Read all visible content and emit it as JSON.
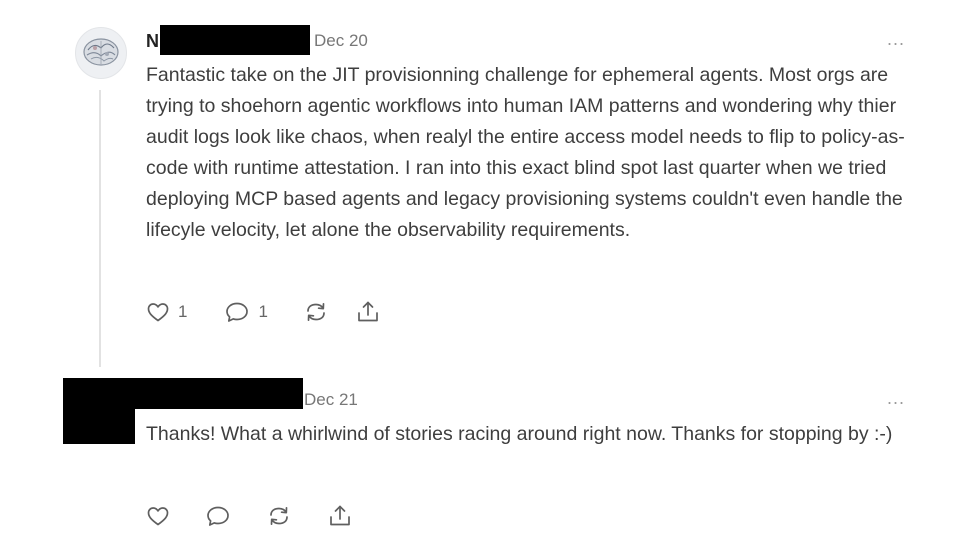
{
  "comments": [
    {
      "author_initial": "N",
      "date": "Dec 20",
      "more_label": "...",
      "text": "Fantastic take on the JIT provisionning challenge for ephemeral agents. Most orgs are trying to shoehorn agentic workflows into human IAM patterns and wondering why thier audit logs look like chaos, when realyl the entire access model needs to flip to policy-as-code with runtime attestation. I ran into this exact blind spot last quarter when we tried deploying MCP based agents and legacy provisioning systems couldn't even handle the lifecyle velocity, let alone the observability requirements.",
      "likes": "1",
      "replies": "1"
    },
    {
      "date": "Dec 21",
      "more_label": "...",
      "text": "Thanks! What a whirlwind of stories racing around right now. Thanks for stopping by :-)"
    }
  ],
  "icons": {
    "like": "heart-icon",
    "comment": "comment-bubble-icon",
    "restack": "restack-icon",
    "share": "share-icon"
  },
  "colors": {
    "text": "#3e3e3e",
    "muted": "#777777",
    "icon": "#5f5f5f",
    "thread_line": "#e2e2e2"
  }
}
